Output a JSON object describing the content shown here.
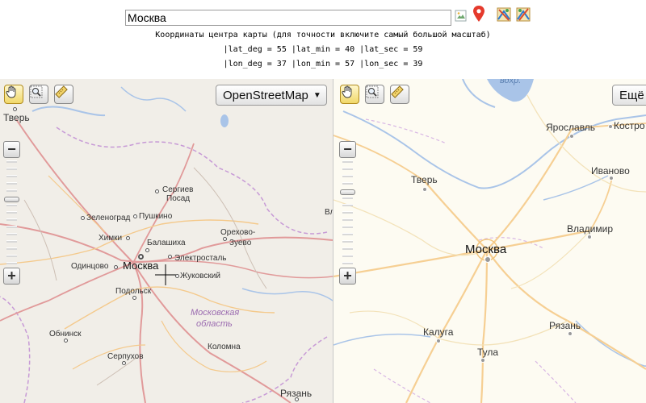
{
  "search": {
    "value": "Москва"
  },
  "coords": {
    "caption": "Координаты центра карты (для точности включите самый большой масштаб)",
    "lat_line": "|lat_deg = 55 |lat_min = 40 |lat_sec = 59",
    "lon_line": "|lon_deg = 37 |lon_min = 57 |lon_sec = 39"
  },
  "left_map": {
    "layer_label": "OpenStreetMap",
    "layer_arrow": "▼",
    "zoom_in": "+",
    "zoom_out": "−",
    "region_label_1": "Московская",
    "region_label_2": "область",
    "cities": {
      "tver": "Тверь",
      "sergiev": "Сергиев",
      "posad": "Посад",
      "zelenograd": "Зеленоград",
      "pushkino": "Пушкино",
      "khimki": "Химки",
      "balashikha": "Балашиха",
      "orekhovo": "Орехово-",
      "zuevo": "Зуево",
      "elektrostal": "Электросталь",
      "odintsovo": "Одинцово",
      "moskva": "Москва",
      "zhukovsky": "Жуковский",
      "podolsk": "Подольск",
      "obninsk": "Обнинск",
      "serpukhov": "Серпухов",
      "kolomna": "Коломна",
      "ryazan": "Рязань",
      "edge_v": "Вл"
    }
  },
  "right_map": {
    "layer_label": "Ещё",
    "zoom_in": "+",
    "zoom_out": "−",
    "water_label": "вдхр.",
    "cities": {
      "yaroslavl": "Ярославль",
      "kostroma": "Костро",
      "tver": "Тверь",
      "ivanovo": "Иваново",
      "vladimir": "Владимир",
      "moskva": "Москва",
      "kaluga": "Калуга",
      "ryazan": "Рязань",
      "tula": "Тула"
    }
  },
  "colors": {
    "osm_background": "#f1eee8",
    "yandex_background": "#fdfbf2",
    "road_red": "#e19a9a",
    "road_orange": "#f4c98b",
    "water": "#a9c4e8",
    "border_purple": "#b66bc9",
    "region_text": "#9b6bb0"
  }
}
